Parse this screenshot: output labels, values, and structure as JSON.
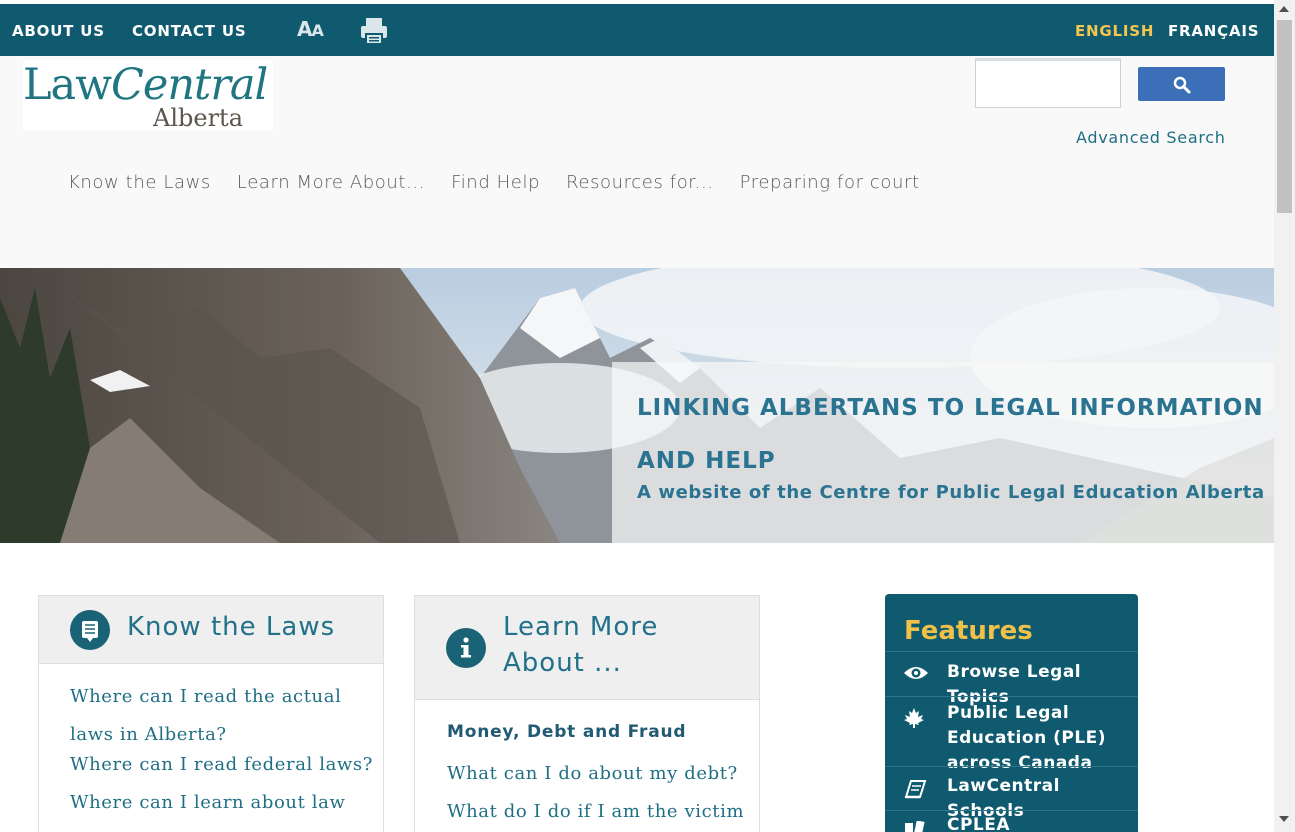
{
  "topbar": {
    "about": "ABOUT US",
    "contact": "CONTACT US",
    "font_size_big": "A",
    "font_size_small": "A",
    "english": "ENGLISH",
    "french": "FRANÇAIS"
  },
  "logo": {
    "word1": "Law",
    "word2": "Central",
    "line2": "Alberta"
  },
  "search": {
    "advanced": "Advanced Search",
    "value": ""
  },
  "nav": [
    "Know the Laws",
    "Learn More About...",
    "Find Help",
    "Resources for...",
    "Preparing for court"
  ],
  "hero": {
    "title": "LINKING ALBERTANS TO LEGAL INFORMATION AND HELP",
    "subtitle": "A website of the Centre for Public Legal Education Alberta"
  },
  "know_laws": {
    "title": "Know the Laws",
    "links": [
      "Where can I read the actual laws in Alberta?",
      "Where can I read federal laws?",
      "Where can I learn about law"
    ]
  },
  "learn_more": {
    "title_line1": "Learn More",
    "title_line2": "About ...",
    "subheading": "Money, Debt and Fraud",
    "links": [
      "What can I do about my debt?",
      "What do I do if I am the victim"
    ]
  },
  "features": {
    "title": "Features",
    "items": [
      {
        "label_line1": "Browse Legal",
        "label_line2": "Topics",
        "icon": "eye-icon"
      },
      {
        "label_line1": "Public Legal",
        "label_line2": "Education (PLE)",
        "label_line3": "across Canada",
        "icon": "maple-leaf-icon"
      },
      {
        "label_line1": "LawCentral Schools",
        "icon": "book-icon"
      },
      {
        "label_line1": "CPLEA Publications",
        "icon": "books-icon"
      }
    ]
  },
  "colors": {
    "brand": "#0f5a6f",
    "accent": "#f4c54f",
    "link": "#1f6f84"
  }
}
